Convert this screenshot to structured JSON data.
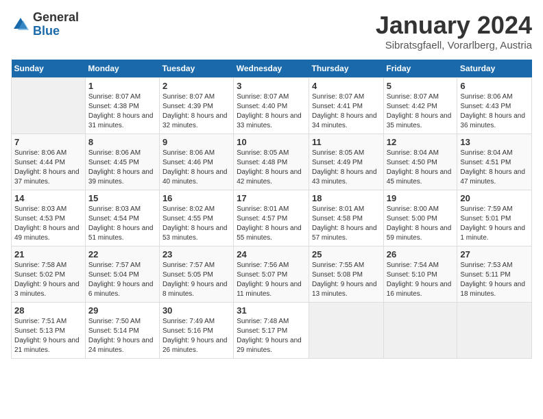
{
  "header": {
    "logo_general": "General",
    "logo_blue": "Blue",
    "month": "January 2024",
    "location": "Sibratsgfaell, Vorarlberg, Austria"
  },
  "weekdays": [
    "Sunday",
    "Monday",
    "Tuesday",
    "Wednesday",
    "Thursday",
    "Friday",
    "Saturday"
  ],
  "weeks": [
    [
      {
        "day": "",
        "sunrise": "",
        "sunset": "",
        "daylight": ""
      },
      {
        "day": "1",
        "sunrise": "Sunrise: 8:07 AM",
        "sunset": "Sunset: 4:38 PM",
        "daylight": "Daylight: 8 hours and 31 minutes."
      },
      {
        "day": "2",
        "sunrise": "Sunrise: 8:07 AM",
        "sunset": "Sunset: 4:39 PM",
        "daylight": "Daylight: 8 hours and 32 minutes."
      },
      {
        "day": "3",
        "sunrise": "Sunrise: 8:07 AM",
        "sunset": "Sunset: 4:40 PM",
        "daylight": "Daylight: 8 hours and 33 minutes."
      },
      {
        "day": "4",
        "sunrise": "Sunrise: 8:07 AM",
        "sunset": "Sunset: 4:41 PM",
        "daylight": "Daylight: 8 hours and 34 minutes."
      },
      {
        "day": "5",
        "sunrise": "Sunrise: 8:07 AM",
        "sunset": "Sunset: 4:42 PM",
        "daylight": "Daylight: 8 hours and 35 minutes."
      },
      {
        "day": "6",
        "sunrise": "Sunrise: 8:06 AM",
        "sunset": "Sunset: 4:43 PM",
        "daylight": "Daylight: 8 hours and 36 minutes."
      }
    ],
    [
      {
        "day": "7",
        "sunrise": "Sunrise: 8:06 AM",
        "sunset": "Sunset: 4:44 PM",
        "daylight": "Daylight: 8 hours and 37 minutes."
      },
      {
        "day": "8",
        "sunrise": "Sunrise: 8:06 AM",
        "sunset": "Sunset: 4:45 PM",
        "daylight": "Daylight: 8 hours and 39 minutes."
      },
      {
        "day": "9",
        "sunrise": "Sunrise: 8:06 AM",
        "sunset": "Sunset: 4:46 PM",
        "daylight": "Daylight: 8 hours and 40 minutes."
      },
      {
        "day": "10",
        "sunrise": "Sunrise: 8:05 AM",
        "sunset": "Sunset: 4:48 PM",
        "daylight": "Daylight: 8 hours and 42 minutes."
      },
      {
        "day": "11",
        "sunrise": "Sunrise: 8:05 AM",
        "sunset": "Sunset: 4:49 PM",
        "daylight": "Daylight: 8 hours and 43 minutes."
      },
      {
        "day": "12",
        "sunrise": "Sunrise: 8:04 AM",
        "sunset": "Sunset: 4:50 PM",
        "daylight": "Daylight: 8 hours and 45 minutes."
      },
      {
        "day": "13",
        "sunrise": "Sunrise: 8:04 AM",
        "sunset": "Sunset: 4:51 PM",
        "daylight": "Daylight: 8 hours and 47 minutes."
      }
    ],
    [
      {
        "day": "14",
        "sunrise": "Sunrise: 8:03 AM",
        "sunset": "Sunset: 4:53 PM",
        "daylight": "Daylight: 8 hours and 49 minutes."
      },
      {
        "day": "15",
        "sunrise": "Sunrise: 8:03 AM",
        "sunset": "Sunset: 4:54 PM",
        "daylight": "Daylight: 8 hours and 51 minutes."
      },
      {
        "day": "16",
        "sunrise": "Sunrise: 8:02 AM",
        "sunset": "Sunset: 4:55 PM",
        "daylight": "Daylight: 8 hours and 53 minutes."
      },
      {
        "day": "17",
        "sunrise": "Sunrise: 8:01 AM",
        "sunset": "Sunset: 4:57 PM",
        "daylight": "Daylight: 8 hours and 55 minutes."
      },
      {
        "day": "18",
        "sunrise": "Sunrise: 8:01 AM",
        "sunset": "Sunset: 4:58 PM",
        "daylight": "Daylight: 8 hours and 57 minutes."
      },
      {
        "day": "19",
        "sunrise": "Sunrise: 8:00 AM",
        "sunset": "Sunset: 5:00 PM",
        "daylight": "Daylight: 8 hours and 59 minutes."
      },
      {
        "day": "20",
        "sunrise": "Sunrise: 7:59 AM",
        "sunset": "Sunset: 5:01 PM",
        "daylight": "Daylight: 9 hours and 1 minute."
      }
    ],
    [
      {
        "day": "21",
        "sunrise": "Sunrise: 7:58 AM",
        "sunset": "Sunset: 5:02 PM",
        "daylight": "Daylight: 9 hours and 3 minutes."
      },
      {
        "day": "22",
        "sunrise": "Sunrise: 7:57 AM",
        "sunset": "Sunset: 5:04 PM",
        "daylight": "Daylight: 9 hours and 6 minutes."
      },
      {
        "day": "23",
        "sunrise": "Sunrise: 7:57 AM",
        "sunset": "Sunset: 5:05 PM",
        "daylight": "Daylight: 9 hours and 8 minutes."
      },
      {
        "day": "24",
        "sunrise": "Sunrise: 7:56 AM",
        "sunset": "Sunset: 5:07 PM",
        "daylight": "Daylight: 9 hours and 11 minutes."
      },
      {
        "day": "25",
        "sunrise": "Sunrise: 7:55 AM",
        "sunset": "Sunset: 5:08 PM",
        "daylight": "Daylight: 9 hours and 13 minutes."
      },
      {
        "day": "26",
        "sunrise": "Sunrise: 7:54 AM",
        "sunset": "Sunset: 5:10 PM",
        "daylight": "Daylight: 9 hours and 16 minutes."
      },
      {
        "day": "27",
        "sunrise": "Sunrise: 7:53 AM",
        "sunset": "Sunset: 5:11 PM",
        "daylight": "Daylight: 9 hours and 18 minutes."
      }
    ],
    [
      {
        "day": "28",
        "sunrise": "Sunrise: 7:51 AM",
        "sunset": "Sunset: 5:13 PM",
        "daylight": "Daylight: 9 hours and 21 minutes."
      },
      {
        "day": "29",
        "sunrise": "Sunrise: 7:50 AM",
        "sunset": "Sunset: 5:14 PM",
        "daylight": "Daylight: 9 hours and 24 minutes."
      },
      {
        "day": "30",
        "sunrise": "Sunrise: 7:49 AM",
        "sunset": "Sunset: 5:16 PM",
        "daylight": "Daylight: 9 hours and 26 minutes."
      },
      {
        "day": "31",
        "sunrise": "Sunrise: 7:48 AM",
        "sunset": "Sunset: 5:17 PM",
        "daylight": "Daylight: 9 hours and 29 minutes."
      },
      {
        "day": "",
        "sunrise": "",
        "sunset": "",
        "daylight": ""
      },
      {
        "day": "",
        "sunrise": "",
        "sunset": "",
        "daylight": ""
      },
      {
        "day": "",
        "sunrise": "",
        "sunset": "",
        "daylight": ""
      }
    ]
  ]
}
